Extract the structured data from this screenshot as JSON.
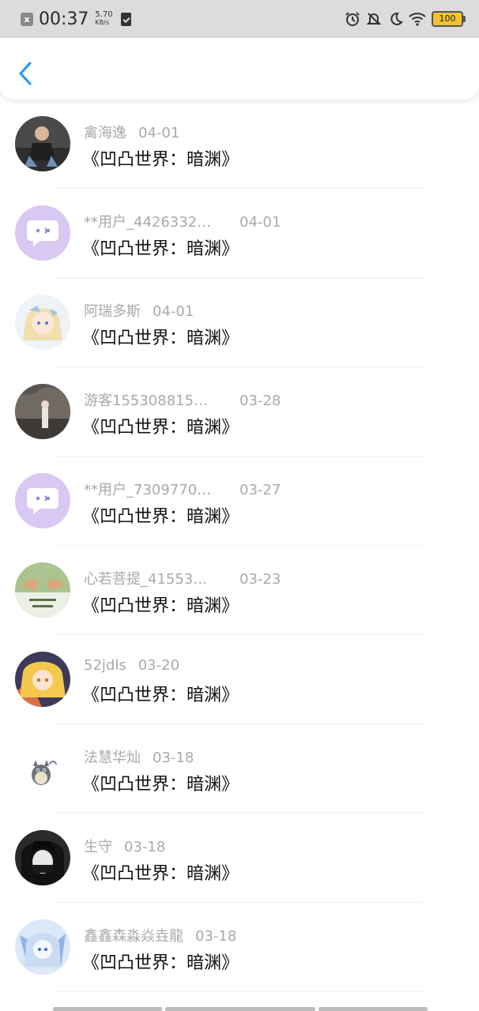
{
  "status_bar": {
    "notification_icon": "x",
    "time": "00:37",
    "speed_value": "5.70",
    "speed_unit": "KB/s",
    "battery": "100"
  },
  "items": [
    {
      "name": "禽海逸",
      "date": "04-01",
      "title": "《凹凸世界：暗渊》",
      "avatar": "photo-person"
    },
    {
      "name": "**用户_4426332…",
      "date": "04-01",
      "title": "《凹凸世界：暗渊》",
      "avatar": "purple-bubble"
    },
    {
      "name": "阿瑞多斯",
      "date": "04-01",
      "title": "《凹凸世界：暗渊》",
      "avatar": "anime-girl"
    },
    {
      "name": "游客155308815…",
      "date": "03-28",
      "title": "《凹凸世界：暗渊》",
      "avatar": "photo-outdoor"
    },
    {
      "name": "**用户_7309770…",
      "date": "03-27",
      "title": "《凹凸世界：暗渊》",
      "avatar": "purple-bubble"
    },
    {
      "name": "心若菩提_41553…",
      "date": "03-23",
      "title": "《凹凸世界：暗渊》",
      "avatar": "hands-text"
    },
    {
      "name": "52jdls",
      "date": "03-20",
      "title": "《凹凸世界：暗渊》",
      "avatar": "anime-blonde"
    },
    {
      "name": "法慧华灿",
      "date": "03-18",
      "title": "《凹凸世界：暗渊》",
      "avatar": "totoro"
    },
    {
      "name": "生守",
      "date": "03-18",
      "title": "《凹凸世界：暗渊》",
      "avatar": "dark-anime"
    },
    {
      "name": "鑫鑫森淼焱垚龍",
      "date": "03-18",
      "title": "《凹凸世界：暗渊》",
      "avatar": "blue-anime"
    }
  ]
}
